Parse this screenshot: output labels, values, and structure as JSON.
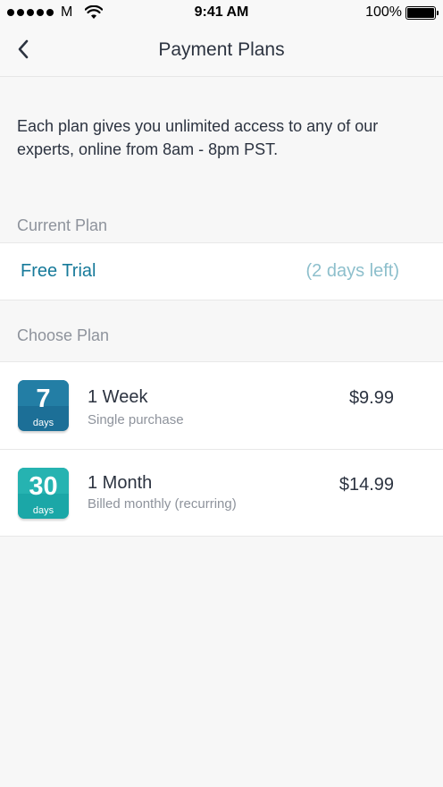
{
  "status_bar": {
    "carrier": "M",
    "time": "9:41 AM",
    "battery": "100%"
  },
  "nav": {
    "title": "Payment Plans",
    "back_icon": "chevron-left-icon"
  },
  "intro_text": "Each plan gives you unlimited access to any of our experts, online from 8am - 8pm PST.",
  "current_plan": {
    "header": "Current Plan",
    "name": "Free Trial",
    "remaining": "(2 days left)"
  },
  "choose_plan": {
    "header": "Choose Plan",
    "plans": [
      {
        "badge_number": "7",
        "badge_unit": "days",
        "title": "1 Week",
        "subtitle": "Single purchase",
        "price": "$9.99",
        "badge_color": "#1c6f97",
        "badge_color_top": "#237ea5"
      },
      {
        "badge_number": "30",
        "badge_unit": "days",
        "title": "1 Month",
        "subtitle": "Billed monthly (recurring)",
        "price": "$14.99",
        "badge_color": "#1ba7a7",
        "badge_color_top": "#26b3b1"
      }
    ]
  },
  "colors": {
    "accent": "#177a9a",
    "muted_accent": "#8dbfcc",
    "section_header": "#8e939c",
    "background": "#f7f7f7"
  }
}
